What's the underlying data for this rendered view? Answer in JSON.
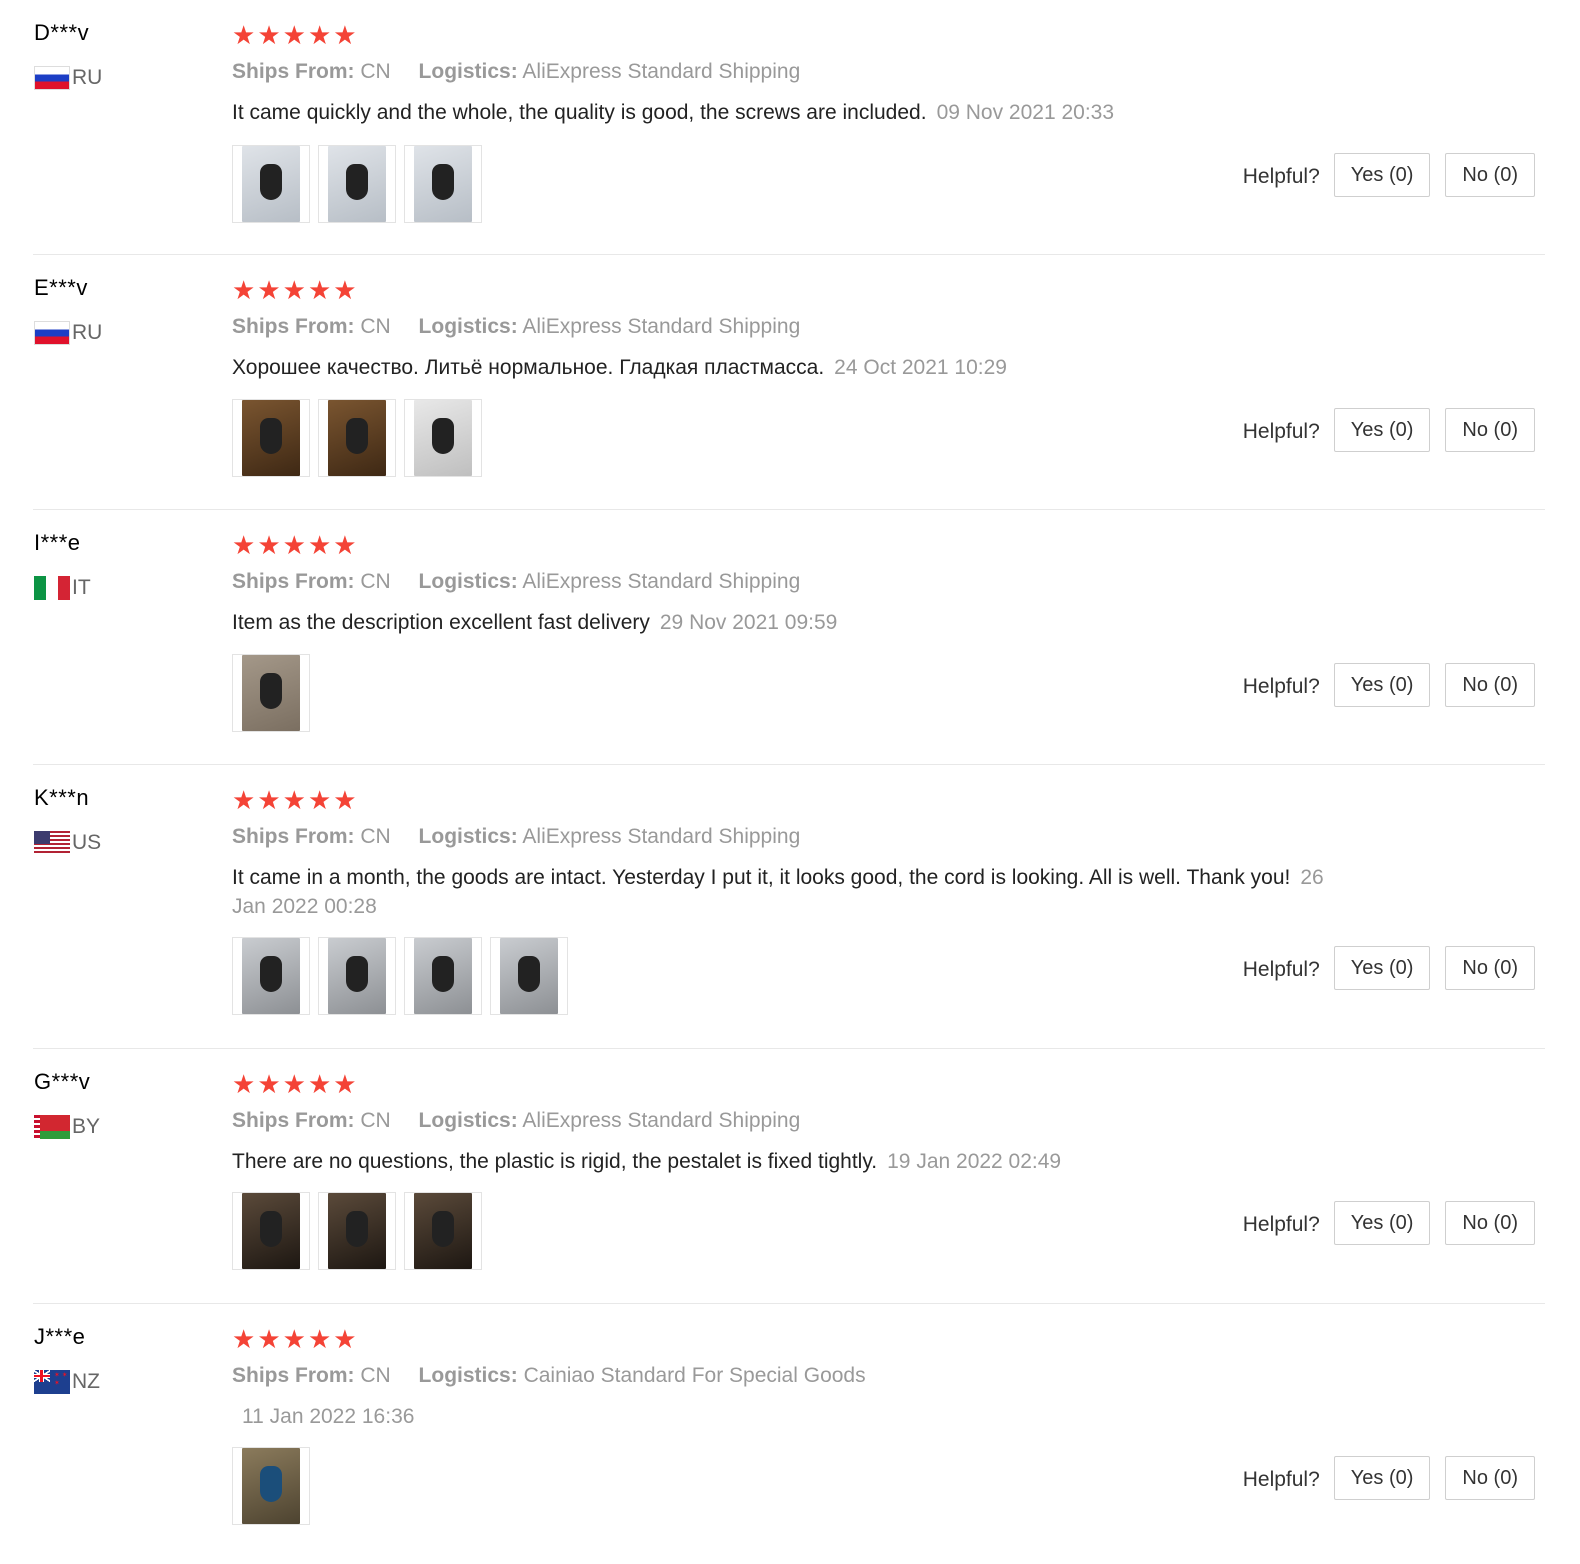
{
  "helpful_label": "Helpful?",
  "ships_from_label": "Ships From:",
  "logistics_label": "Logistics:",
  "star_icon": "★",
  "reviews": [
    {
      "user": "D***v",
      "country": "RU",
      "flag": "russia-flag",
      "stars": 5,
      "ships_from": "CN",
      "logistics": "AliExpress Standard Shipping",
      "text": "It came quickly and the whole, the quality is good, the screws are included.",
      "date": "09 Nov 2021 20:33",
      "photos": [
        "light",
        "light",
        "light"
      ],
      "yes": "Yes (0)",
      "no": "No (0)"
    },
    {
      "user": "E***v",
      "country": "RU",
      "flag": "russia-flag",
      "stars": 5,
      "ships_from": "CN",
      "logistics": "AliExpress Standard Shipping",
      "text": "Хорошее качество. Литьё нормальное. Гладкая пластмасса.",
      "date": "24 Oct 2021 10:29",
      "photos": [
        "wood",
        "wood",
        "white"
      ],
      "yes": "Yes (0)",
      "no": "No (0)"
    },
    {
      "user": "I***e",
      "country": "IT",
      "flag": "italy-flag",
      "stars": 5,
      "ships_from": "CN",
      "logistics": "AliExpress Standard Shipping",
      "text": "Item as the description excellent fast delivery",
      "date": "29 Nov 2021 09:59",
      "photos": [
        "floor"
      ],
      "yes": "Yes (0)",
      "no": "No (0)"
    },
    {
      "user": "K***n",
      "country": "US",
      "flag": "usa-flag",
      "stars": 5,
      "ships_from": "CN",
      "logistics": "AliExpress Standard Shipping",
      "text": "It came in a month, the goods are intact. Yesterday I put it, it looks good, the cord is looking. All is well. Thank you!",
      "date": "26 Jan 2022 00:28",
      "photos": [
        "outdoor",
        "outdoor",
        "outdoor",
        "outdoor"
      ],
      "yes": "Yes (0)",
      "no": "No (0)"
    },
    {
      "user": "G***v",
      "country": "BY",
      "flag": "belarus-flag",
      "stars": 5,
      "ships_from": "CN",
      "logistics": "AliExpress Standard Shipping",
      "text": "There are no questions, the plastic is rigid, the pestalet is fixed tightly.",
      "date": "19 Jan 2022 02:49",
      "photos": [
        "dark",
        "dark",
        "dark"
      ],
      "yes": "Yes (0)",
      "no": "No (0)"
    },
    {
      "user": "J***e",
      "country": "NZ",
      "flag": "new-zealand-flag",
      "stars": 5,
      "ships_from": "CN",
      "logistics": "Cainiao Standard For Special Goods",
      "text": "",
      "date": "11 Jan 2022 16:36",
      "photos": [
        "blue"
      ],
      "yes": "Yes (0)",
      "no": "No (0)"
    }
  ]
}
